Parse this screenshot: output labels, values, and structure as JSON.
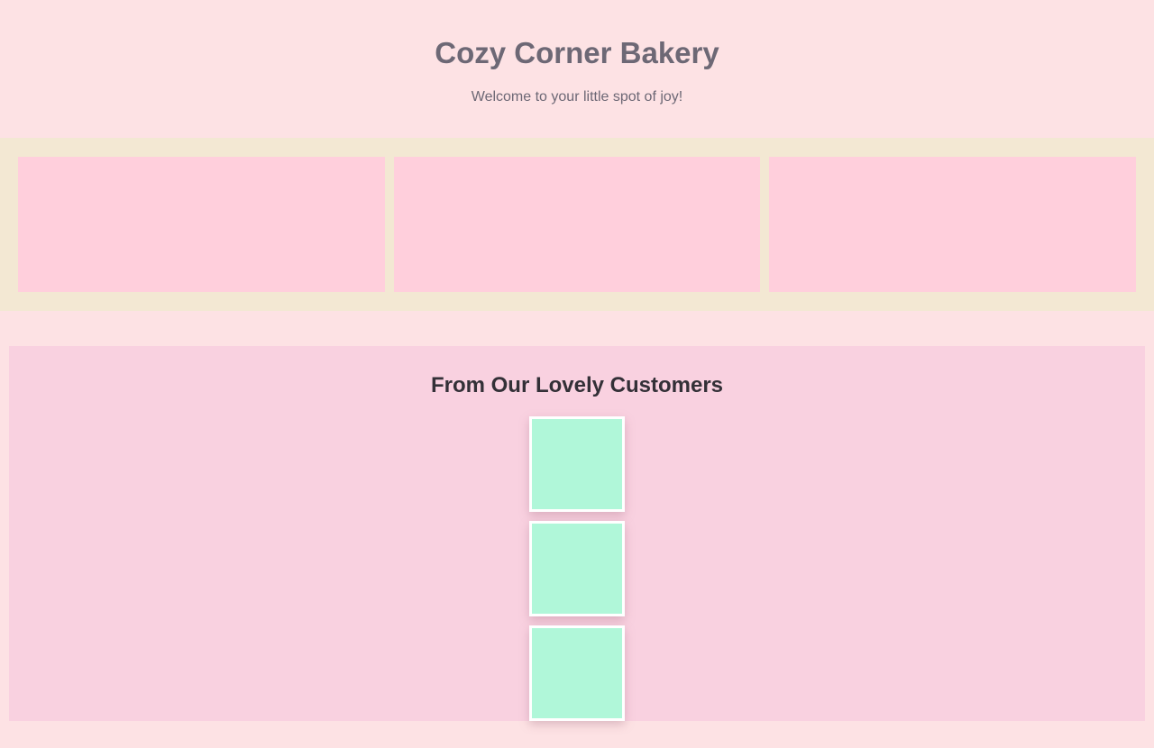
{
  "header": {
    "title": "Cozy Corner Bakery",
    "tagline": "Welcome to your little spot of joy!"
  },
  "gallery": {
    "tile_count": 3
  },
  "testimonials": {
    "heading": "From Our Lovely Customers",
    "customer_count": 3
  },
  "colors": {
    "background": "#fde2e4",
    "gallery_band": "#f3e8d3",
    "gallery_tile": "#ffcfdc",
    "testimonials_panel": "#f9d1e0",
    "customer_photo": "#b0f7d9",
    "text_muted": "#6d6875",
    "text_dark": "#333037"
  }
}
